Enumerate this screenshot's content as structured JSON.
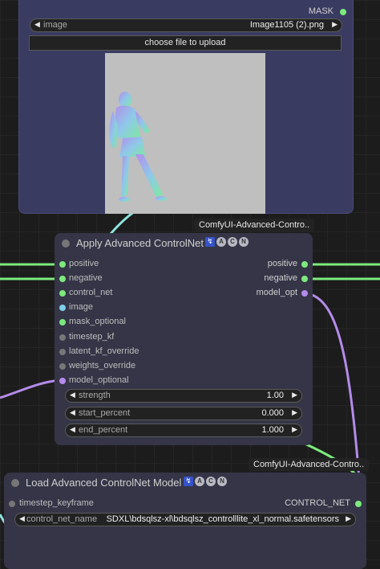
{
  "load_image_node": {
    "output_mask_label": "MASK",
    "image_combo": {
      "label": "image",
      "value": "Image1105 (2).png"
    },
    "upload_button_label": "choose file to upload",
    "preview_alt": "depth/normal map figure preview"
  },
  "source_tags": {
    "apply_source": "ComfyUI-Advanced-Contro..",
    "load_source": "ComfyUI-Advanced-Contro.."
  },
  "apply_node": {
    "title": "Apply Advanced ControlNet",
    "badges": [
      "\u0001",
      "A",
      "C",
      "N"
    ],
    "inputs": [
      {
        "label": "positive",
        "color": "#7dea7d"
      },
      {
        "label": "negative",
        "color": "#7dea7d"
      },
      {
        "label": "control_net",
        "color": "#7dea7d"
      },
      {
        "label": "image",
        "color": "#7fd0ea"
      },
      {
        "label": "mask_optional",
        "color": "#7dea7d"
      },
      {
        "label": "timestep_kf",
        "color": "#777777"
      },
      {
        "label": "latent_kf_override",
        "color": "#777777"
      },
      {
        "label": "weights_override",
        "color": "#777777"
      },
      {
        "label": "model_optional",
        "color": "#b48bea"
      }
    ],
    "outputs": [
      {
        "label": "positive",
        "color": "#7dea7d"
      },
      {
        "label": "negative",
        "color": "#7dea7d"
      },
      {
        "label": "model_opt",
        "color": "#b48bea"
      }
    ],
    "widgets": [
      {
        "label": "strength",
        "value": "1.00"
      },
      {
        "label": "start_percent",
        "value": "0.000"
      },
      {
        "label": "end_percent",
        "value": "1.000"
      }
    ]
  },
  "load_node": {
    "title": "Load Advanced ControlNet Model",
    "badges": [
      "A",
      "C",
      "N"
    ],
    "input": {
      "label": "timestep_keyframe",
      "color": "#777777"
    },
    "output": {
      "label": "CONTROL_NET",
      "color": "#7dea7d"
    },
    "widget": {
      "label": "control_net_name",
      "value": "SDXL\\bdsqlsz-xl\\bdsqlsz_controlllite_xl_normal.safetensors"
    }
  },
  "colors": {
    "conditioning_wire": "#7dea7d",
    "image_wire": "#8fe3dd",
    "model_wire": "#b48bea"
  }
}
